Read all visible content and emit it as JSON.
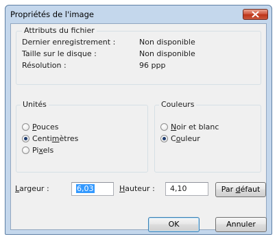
{
  "window": {
    "title": "Propriétés de l'image"
  },
  "file_attributes": {
    "legend": "Attributs du fichier",
    "rows": [
      {
        "label": "Dernier enregistrement :",
        "value": "Non disponible"
      },
      {
        "label": "Taille sur le disque :",
        "value": "Non disponible"
      },
      {
        "label": "Résolution :",
        "value": "96 ppp"
      }
    ]
  },
  "units": {
    "legend": "Unités",
    "options": [
      {
        "pre": "",
        "key": "P",
        "post": "ouces",
        "checked": false
      },
      {
        "pre": "Centi",
        "key": "m",
        "post": "ètres",
        "checked": true
      },
      {
        "pre": "Pi",
        "key": "x",
        "post": "els",
        "checked": false
      }
    ]
  },
  "colors": {
    "legend": "Couleurs",
    "options": [
      {
        "pre": "",
        "key": "N",
        "post": "oir et blanc",
        "checked": false
      },
      {
        "pre": "C",
        "key": "o",
        "post": "uleur",
        "checked": true
      }
    ]
  },
  "size": {
    "width": {
      "pre": "",
      "key": "L",
      "post": "argeur :",
      "value": "6,03"
    },
    "height": {
      "pre": "",
      "key": "H",
      "post": "auteur :",
      "value": "4,10"
    }
  },
  "buttons": {
    "default_size": {
      "pre": "Par ",
      "key": "d",
      "post": "éfaut"
    },
    "ok": "OK",
    "cancel": "Annuler"
  }
}
